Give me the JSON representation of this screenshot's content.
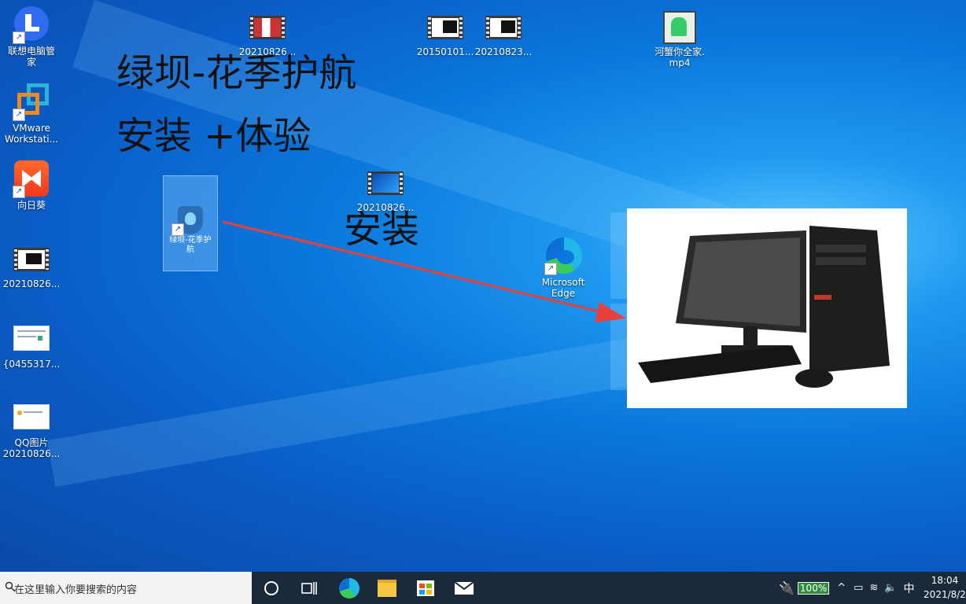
{
  "desktop_icons": [
    {
      "label_line1": "联想电脑管",
      "label_line2": "家",
      "icon": "lenovo-pc-manager-icon"
    },
    {
      "label_line1": "VMware",
      "label_line2": "Workstati...",
      "icon": "vmware-icon"
    },
    {
      "label_line1": "向日葵",
      "label_line2": "",
      "icon": "sunflower-icon"
    },
    {
      "label_line1": "20210826...",
      "label_line2": "",
      "icon": "video-file-icon"
    },
    {
      "label_line1": "{0455317...",
      "label_line2": "",
      "icon": "image-file-icon"
    },
    {
      "label_line1": "QQ图片",
      "label_line2": "20210826...",
      "icon": "image-file-icon"
    }
  ],
  "top_icons": [
    {
      "label": "20210826...",
      "icon": "video-file-icon"
    },
    {
      "label": "20150101...",
      "icon": "video-file-icon"
    },
    {
      "label": "20210823...",
      "icon": "video-file-icon"
    },
    {
      "label_line1": "河蟹你全家.",
      "label_line2": "mp4",
      "icon": "video-file-icon"
    }
  ],
  "mid_video": {
    "label": "20210826...",
    "icon": "video-file-icon"
  },
  "edge_icon": {
    "label_line1": "Microsoft",
    "label_line2": "Edge"
  },
  "selected_shortcut": {
    "label": "绿坝-花季护航"
  },
  "overlay": {
    "title": "绿坝-花季护航",
    "subtitle": "安装  +体验",
    "install": "安装"
  },
  "taskbar": {
    "search_placeholder": "在这里输入你要搜索的内容",
    "battery": "100%",
    "ime": "中",
    "time": "18:04",
    "date": "2021/8/2"
  },
  "colors": {
    "arrow": "#e8413b",
    "taskbar": "#1b2a3a"
  }
}
